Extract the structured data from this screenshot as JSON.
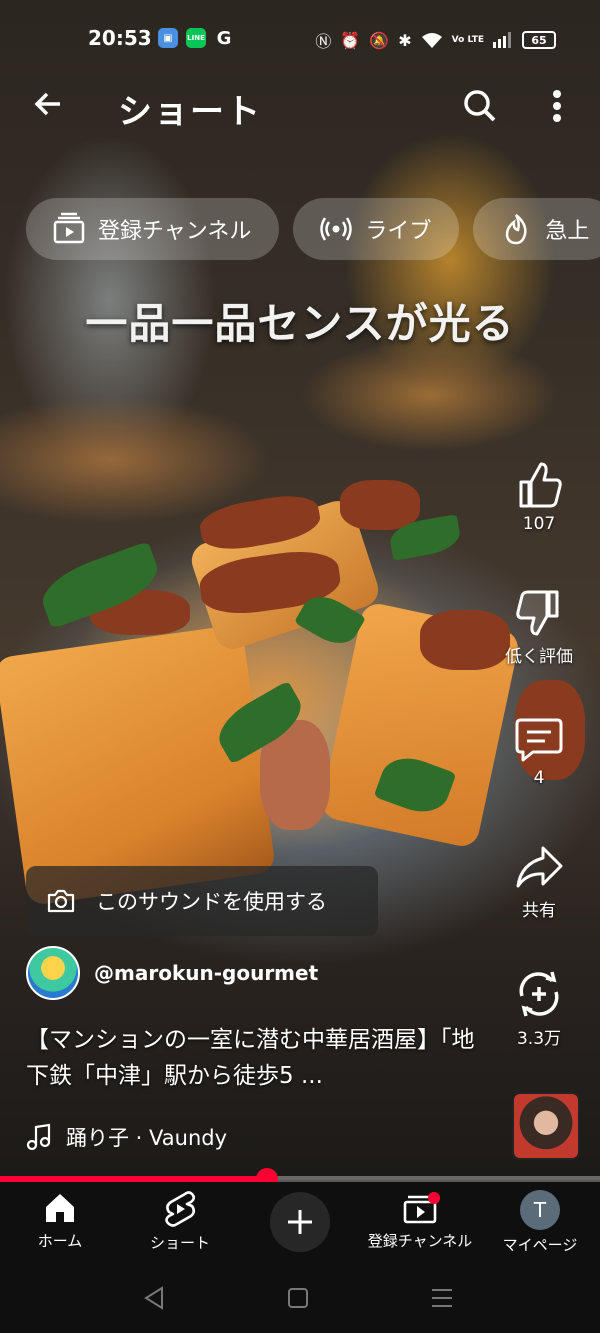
{
  "status_bar": {
    "time": "20:53",
    "apps": [
      "G"
    ],
    "line_label": "LINE",
    "network": "Vo LTE",
    "battery": "65"
  },
  "header": {
    "title": "ショート",
    "icons": [
      "back-arrow-icon",
      "search-icon",
      "more-vert-icon"
    ]
  },
  "chips": [
    {
      "label": "登録チャンネル",
      "icon": "subscriptions-icon"
    },
    {
      "label": "ライブ",
      "icon": "live-icon"
    },
    {
      "label": "急上",
      "icon": "trending-icon"
    }
  ],
  "video": {
    "overlay_text": "一品一品センスが光る"
  },
  "actions": {
    "like_count": "107",
    "dislike_label": "低く評価",
    "comment_count": "4",
    "share_label": "共有",
    "remix_count": "3.3万"
  },
  "sound_button": {
    "label": "このサウンドを使用する"
  },
  "channel": {
    "handle": "@marokun-gourmet"
  },
  "description": {
    "text": "【マンションの一室に潜む中華居酒屋】「地下鉄「中津」駅から徒歩5 ..."
  },
  "music": {
    "track": "踊り子 · Vaundy"
  },
  "progress": {
    "fraction": 0.445
  },
  "bottom_nav": {
    "items": [
      {
        "label": "ホーム",
        "icon": "home-icon"
      },
      {
        "label": "ショート",
        "icon": "shorts-icon"
      },
      {
        "label": "",
        "icon": "plus-icon"
      },
      {
        "label": "登録チャンネル",
        "icon": "subscriptions-icon"
      },
      {
        "label": "マイページ",
        "icon": "avatar"
      }
    ],
    "avatar_letter": "T"
  },
  "colors": {
    "accent": "#ff0033",
    "nav_bg": "#0f0f0f"
  }
}
